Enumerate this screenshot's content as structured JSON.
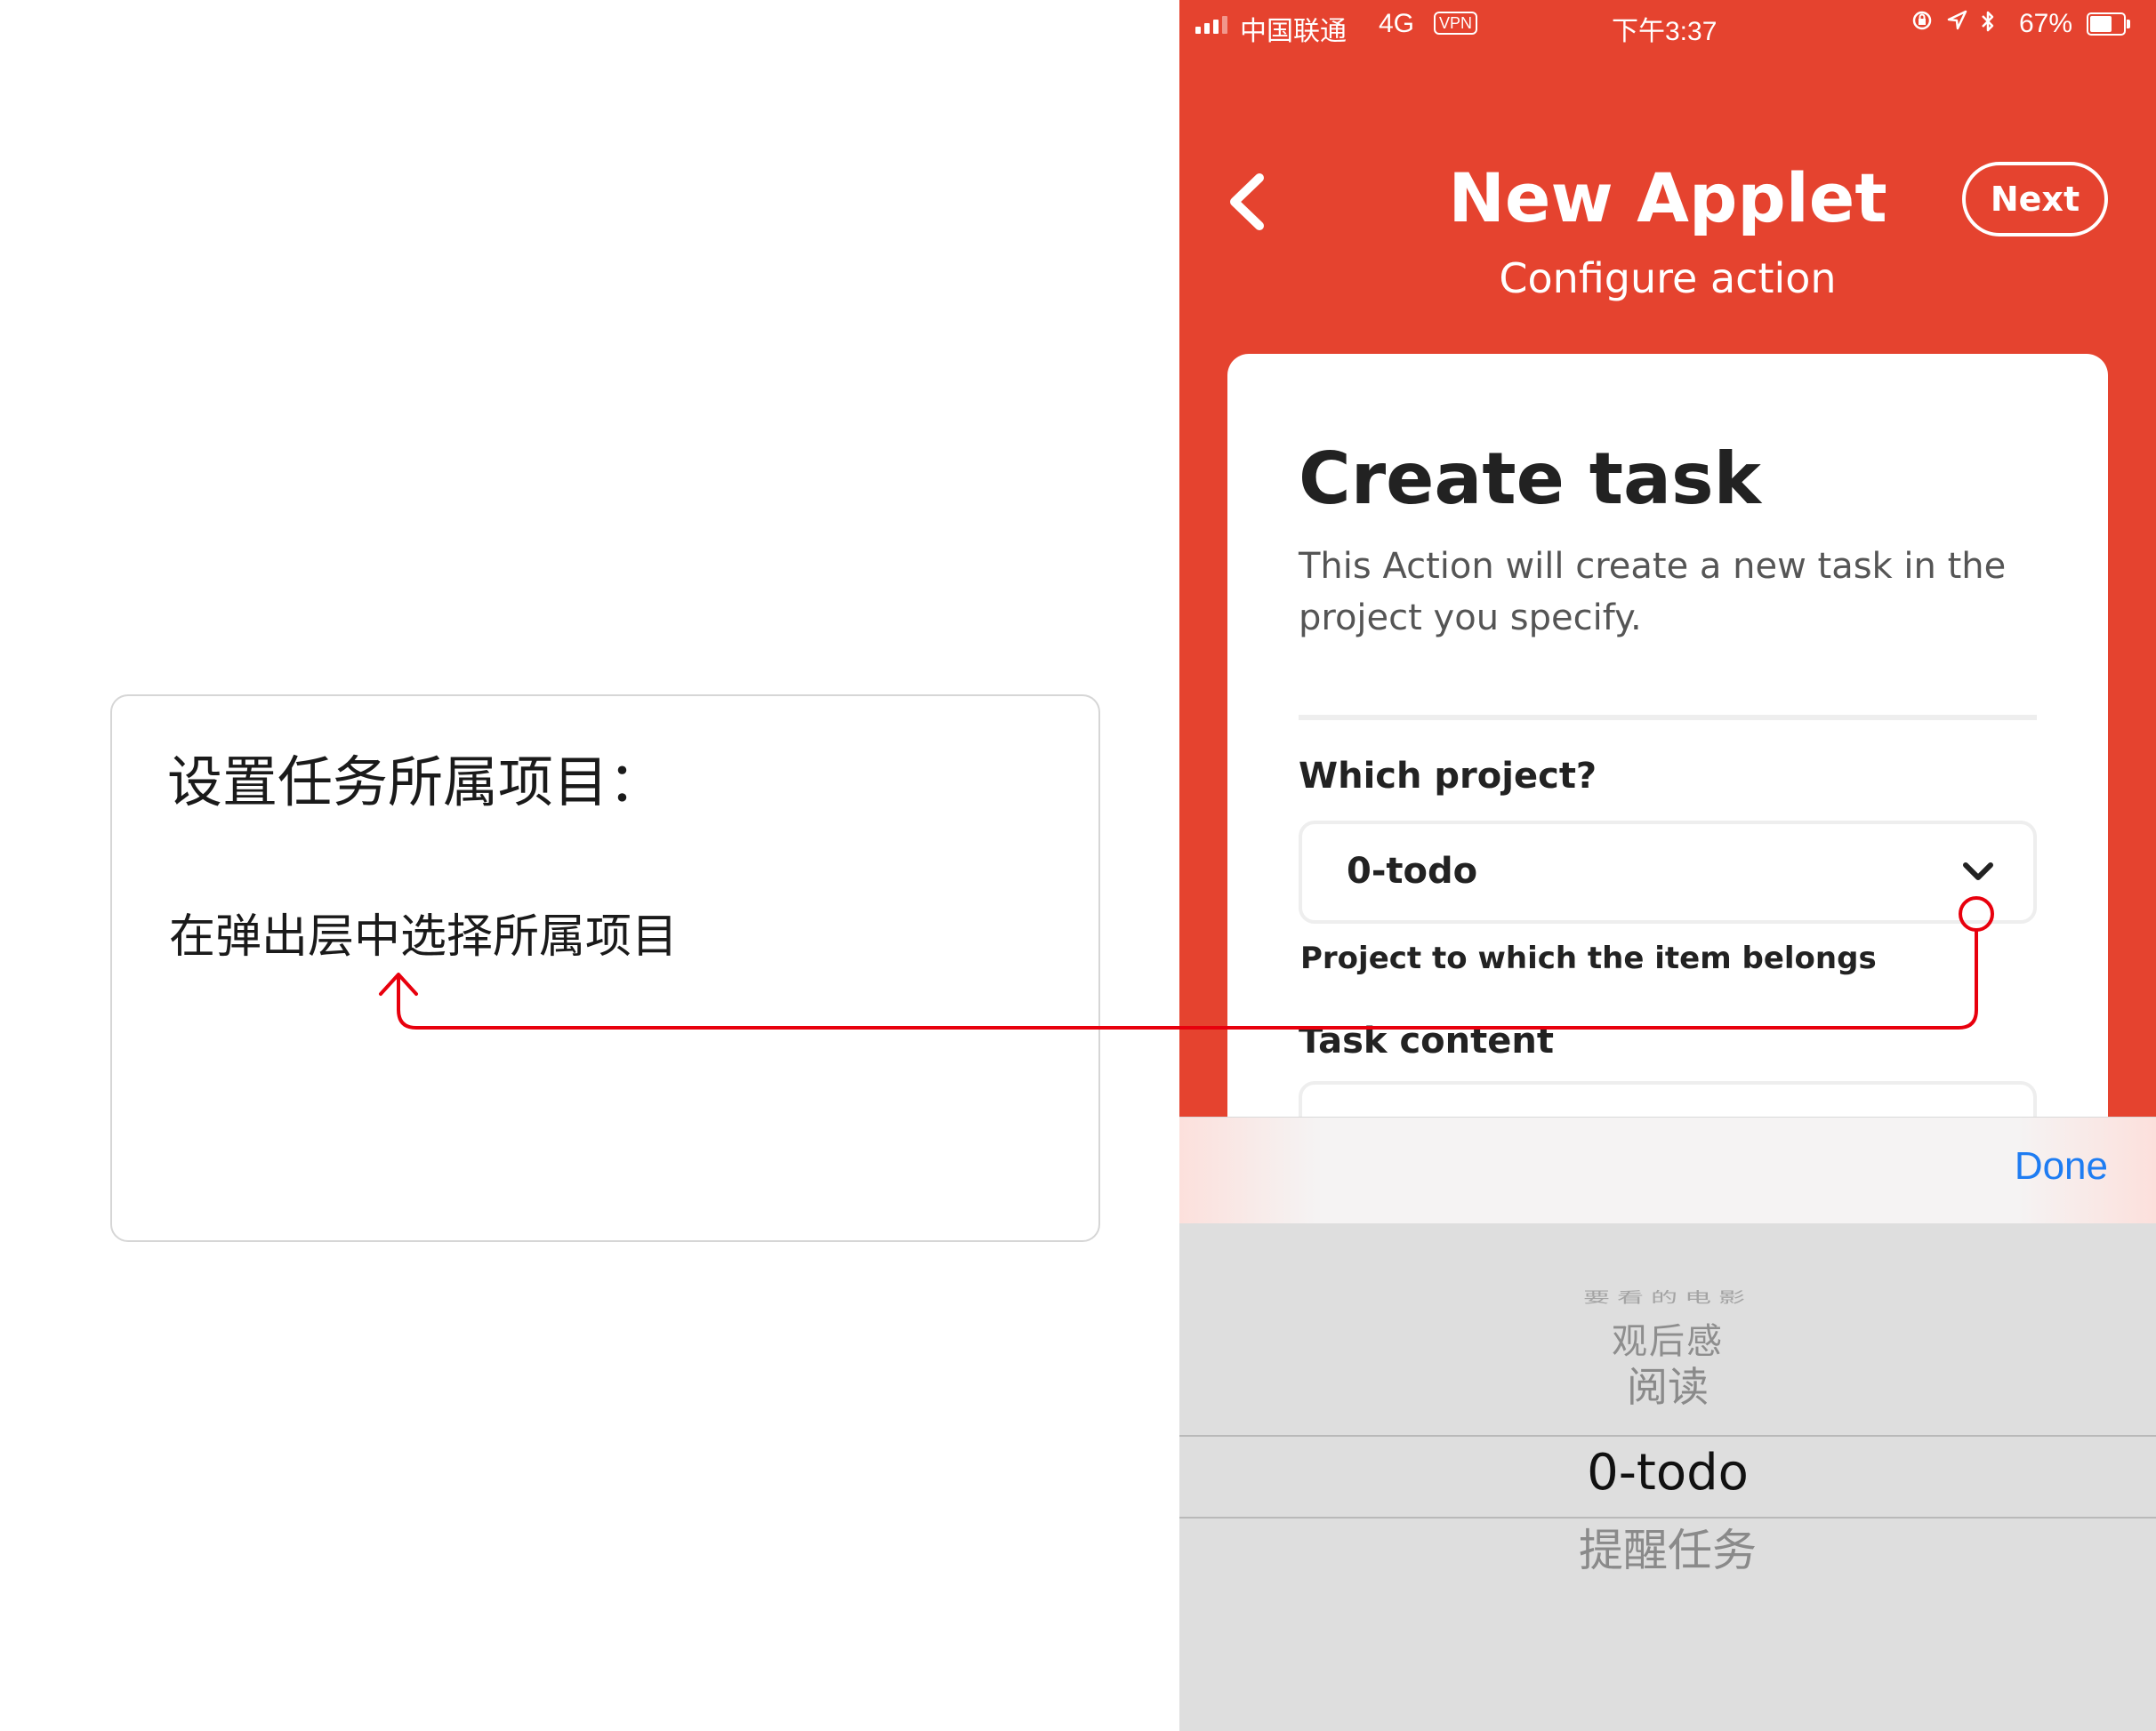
{
  "annotation": {
    "title": "设置任务所属项目：",
    "body": "在弹出层中选择所属项目"
  },
  "status_bar": {
    "carrier": "中国联通",
    "network": "4G",
    "vpn": "VPN",
    "time": "下午3:37",
    "battery_percent": "67%",
    "battery_level": 0.67,
    "icons": [
      "orientation-lock-icon",
      "location-icon",
      "bluetooth-icon"
    ]
  },
  "nav": {
    "title": "New Applet",
    "subtitle": "Configure action",
    "next_label": "Next"
  },
  "card": {
    "title": "Create task",
    "description": "This Action will create a new task in the project you specify.",
    "project_label": "Which project?",
    "project_value": "0-todo",
    "project_help": "Project to which the item belongs",
    "task_content_label": "Task content"
  },
  "picker": {
    "done_label": "Done",
    "items": [
      "要看的电影",
      "观后感",
      "阅读",
      "0-todo",
      "提醒任务"
    ],
    "selected": "0-todo"
  },
  "colors": {
    "brand_red": "#e5432f",
    "done_blue": "#1e7cf2",
    "annotation_arrow": "#e8000d"
  }
}
